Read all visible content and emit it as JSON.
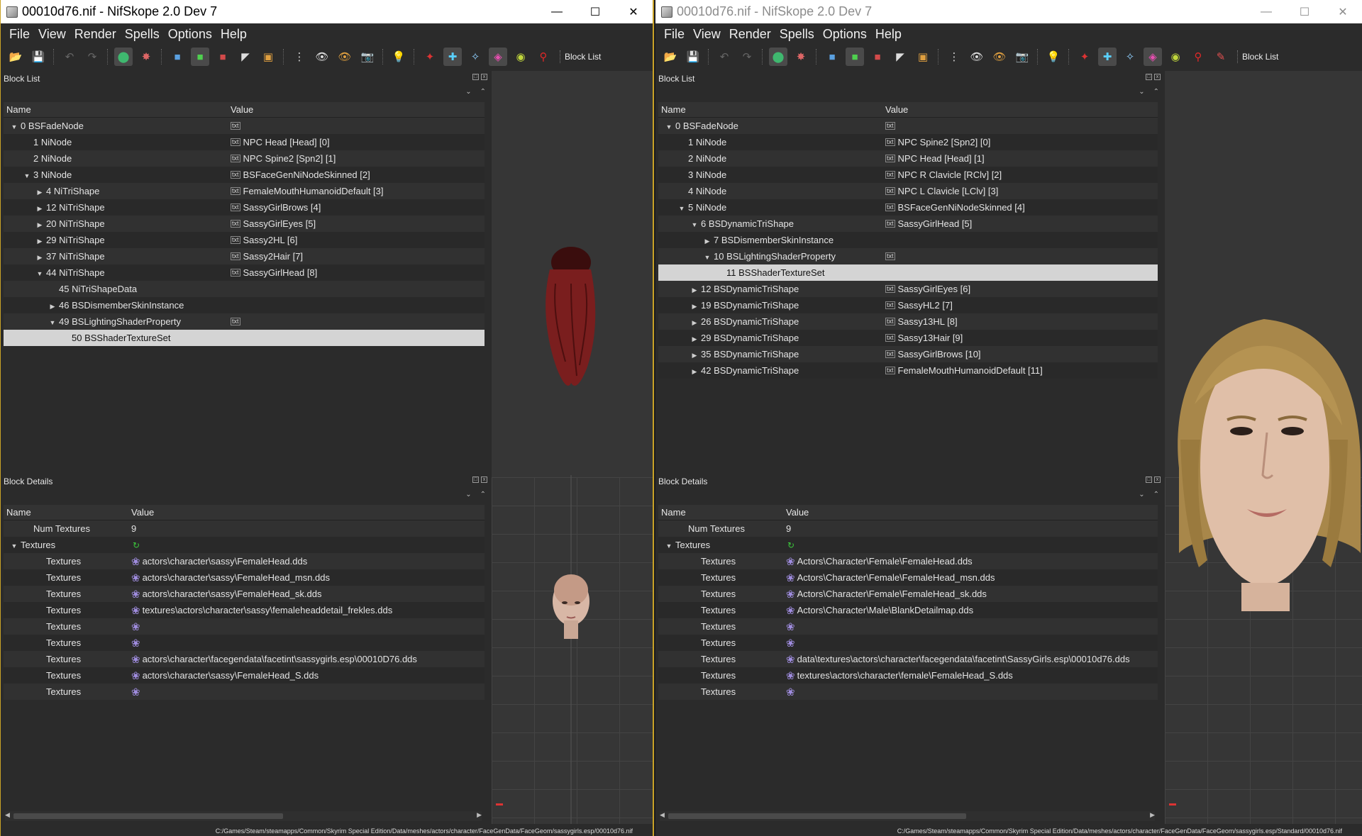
{
  "left": {
    "title": "00010d76.nif - NifSkope 2.0 Dev 7",
    "menu": [
      "File",
      "View",
      "Render",
      "Spells",
      "Options",
      "Help"
    ],
    "blocklist_button": "Block List",
    "block_list": {
      "title": "Block List",
      "headers": [
        "Name",
        "Value"
      ],
      "rows": [
        {
          "indent": 0,
          "arrow": "down",
          "name": "0 BSFadeNode",
          "icon": true,
          "value": ""
        },
        {
          "indent": 1,
          "arrow": "",
          "name": "1 NiNode",
          "icon": true,
          "value": "NPC Head [Head] [0]"
        },
        {
          "indent": 1,
          "arrow": "",
          "name": "2 NiNode",
          "icon": true,
          "value": "NPC Spine2 [Spn2] [1]"
        },
        {
          "indent": 1,
          "arrow": "down",
          "name": "3 NiNode",
          "icon": true,
          "value": "BSFaceGenNiNodeSkinned [2]"
        },
        {
          "indent": 2,
          "arrow": "right",
          "name": "4 NiTriShape",
          "icon": true,
          "value": "FemaleMouthHumanoidDefault [3]"
        },
        {
          "indent": 2,
          "arrow": "right",
          "name": "12 NiTriShape",
          "icon": true,
          "value": "SassyGirlBrows [4]"
        },
        {
          "indent": 2,
          "arrow": "right",
          "name": "20 NiTriShape",
          "icon": true,
          "value": "SassyGirlEyes [5]"
        },
        {
          "indent": 2,
          "arrow": "right",
          "name": "29 NiTriShape",
          "icon": true,
          "value": "Sassy2HL [6]"
        },
        {
          "indent": 2,
          "arrow": "right",
          "name": "37 NiTriShape",
          "icon": true,
          "value": "Sassy2Hair [7]"
        },
        {
          "indent": 2,
          "arrow": "down",
          "name": "44 NiTriShape",
          "icon": true,
          "value": "SassyGirlHead [8]"
        },
        {
          "indent": 3,
          "arrow": "",
          "name": "45 NiTriShapeData",
          "icon": false,
          "value": ""
        },
        {
          "indent": 3,
          "arrow": "right",
          "name": "46 BSDismemberSkinInstance",
          "icon": false,
          "value": ""
        },
        {
          "indent": 3,
          "arrow": "down",
          "name": "49 BSLightingShaderProperty",
          "icon": true,
          "value": ""
        },
        {
          "indent": 4,
          "arrow": "",
          "name": "50 BSShaderTextureSet",
          "icon": false,
          "value": "",
          "selected": true
        }
      ]
    },
    "block_details": {
      "title": "Block Details",
      "headers": [
        "Name",
        "Value"
      ],
      "rows": [
        {
          "indent": 1,
          "arrow": "",
          "name": "Num Textures",
          "icon": "",
          "value": "9"
        },
        {
          "indent": 0,
          "arrow": "down",
          "name": "Textures",
          "icon": "refresh",
          "value": ""
        },
        {
          "indent": 2,
          "arrow": "",
          "name": "Textures",
          "icon": "gear",
          "value": "actors\\character\\sassy\\FemaleHead.dds"
        },
        {
          "indent": 2,
          "arrow": "",
          "name": "Textures",
          "icon": "gear",
          "value": "actors\\character\\sassy\\FemaleHead_msn.dds"
        },
        {
          "indent": 2,
          "arrow": "",
          "name": "Textures",
          "icon": "gear",
          "value": "actors\\character\\sassy\\FemaleHead_sk.dds"
        },
        {
          "indent": 2,
          "arrow": "",
          "name": "Textures",
          "icon": "gear",
          "value": "textures\\actors\\character\\sassy\\femaleheaddetail_frekles.dds"
        },
        {
          "indent": 2,
          "arrow": "",
          "name": "Textures",
          "icon": "gear",
          "value": ""
        },
        {
          "indent": 2,
          "arrow": "",
          "name": "Textures",
          "icon": "gear",
          "value": ""
        },
        {
          "indent": 2,
          "arrow": "",
          "name": "Textures",
          "icon": "gear",
          "value": "actors\\character\\facegendata\\facetint\\sassygirls.esp\\00010D76.dds"
        },
        {
          "indent": 2,
          "arrow": "",
          "name": "Textures",
          "icon": "gear",
          "value": "actors\\character\\sassy\\FemaleHead_S.dds"
        },
        {
          "indent": 2,
          "arrow": "",
          "name": "Textures",
          "icon": "gear",
          "value": ""
        }
      ]
    },
    "status": "C:/Games/Steam/steamapps/Common/Skyrim Special Edition/Data/meshes/actors/character/FaceGenData/FaceGeom/sassygirls.esp/00010d76.nif"
  },
  "right": {
    "title": "00010d76.nif - NifSkope 2.0 Dev 7",
    "menu": [
      "File",
      "View",
      "Render",
      "Spells",
      "Options",
      "Help"
    ],
    "blocklist_button": "Block List",
    "block_list": {
      "title": "Block List",
      "headers": [
        "Name",
        "Value"
      ],
      "rows": [
        {
          "indent": 0,
          "arrow": "down",
          "name": "0 BSFadeNode",
          "icon": true,
          "value": ""
        },
        {
          "indent": 1,
          "arrow": "",
          "name": "1 NiNode",
          "icon": true,
          "value": "NPC Spine2 [Spn2] [0]"
        },
        {
          "indent": 1,
          "arrow": "",
          "name": "2 NiNode",
          "icon": true,
          "value": "NPC Head [Head] [1]"
        },
        {
          "indent": 1,
          "arrow": "",
          "name": "3 NiNode",
          "icon": true,
          "value": "NPC R Clavicle [RClv] [2]"
        },
        {
          "indent": 1,
          "arrow": "",
          "name": "4 NiNode",
          "icon": true,
          "value": "NPC L Clavicle [LClv] [3]"
        },
        {
          "indent": 1,
          "arrow": "down",
          "name": "5 NiNode",
          "icon": true,
          "value": "BSFaceGenNiNodeSkinned [4]"
        },
        {
          "indent": 2,
          "arrow": "down",
          "name": "6 BSDynamicTriShape",
          "icon": true,
          "value": "SassyGirlHead [5]"
        },
        {
          "indent": 3,
          "arrow": "right",
          "name": "7 BSDismemberSkinInstance",
          "icon": false,
          "value": ""
        },
        {
          "indent": 3,
          "arrow": "down",
          "name": "10 BSLightingShaderProperty",
          "icon": true,
          "value": ""
        },
        {
          "indent": 4,
          "arrow": "",
          "name": "11 BSShaderTextureSet",
          "icon": false,
          "value": "",
          "selected": true
        },
        {
          "indent": 2,
          "arrow": "right",
          "name": "12 BSDynamicTriShape",
          "icon": true,
          "value": "SassyGirlEyes [6]"
        },
        {
          "indent": 2,
          "arrow": "right",
          "name": "19 BSDynamicTriShape",
          "icon": true,
          "value": "SassyHL2 [7]"
        },
        {
          "indent": 2,
          "arrow": "right",
          "name": "26 BSDynamicTriShape",
          "icon": true,
          "value": "Sassy13HL [8]"
        },
        {
          "indent": 2,
          "arrow": "right",
          "name": "29 BSDynamicTriShape",
          "icon": true,
          "value": "Sassy13Hair [9]"
        },
        {
          "indent": 2,
          "arrow": "right",
          "name": "35 BSDynamicTriShape",
          "icon": true,
          "value": "SassyGirlBrows [10]"
        },
        {
          "indent": 2,
          "arrow": "right",
          "name": "42 BSDynamicTriShape",
          "icon": true,
          "value": "FemaleMouthHumanoidDefault [11]"
        }
      ]
    },
    "block_details": {
      "title": "Block Details",
      "headers": [
        "Name",
        "Value"
      ],
      "rows": [
        {
          "indent": 1,
          "arrow": "",
          "name": "Num Textures",
          "icon": "",
          "value": "9"
        },
        {
          "indent": 0,
          "arrow": "down",
          "name": "Textures",
          "icon": "refresh",
          "value": ""
        },
        {
          "indent": 2,
          "arrow": "",
          "name": "Textures",
          "icon": "gear",
          "value": "Actors\\Character\\Female\\FemaleHead.dds"
        },
        {
          "indent": 2,
          "arrow": "",
          "name": "Textures",
          "icon": "gear",
          "value": "Actors\\Character\\Female\\FemaleHead_msn.dds"
        },
        {
          "indent": 2,
          "arrow": "",
          "name": "Textures",
          "icon": "gear",
          "value": "Actors\\Character\\Female\\FemaleHead_sk.dds"
        },
        {
          "indent": 2,
          "arrow": "",
          "name": "Textures",
          "icon": "gear",
          "value": "Actors\\Character\\Male\\BlankDetailmap.dds"
        },
        {
          "indent": 2,
          "arrow": "",
          "name": "Textures",
          "icon": "gear",
          "value": ""
        },
        {
          "indent": 2,
          "arrow": "",
          "name": "Textures",
          "icon": "gear",
          "value": ""
        },
        {
          "indent": 2,
          "arrow": "",
          "name": "Textures",
          "icon": "gear",
          "value": "data\\textures\\actors\\character\\facegendata\\facetint\\SassyGirls.esp\\00010d76.dds"
        },
        {
          "indent": 2,
          "arrow": "",
          "name": "Textures",
          "icon": "gear",
          "value": "textures\\actors\\character\\female\\FemaleHead_S.dds"
        },
        {
          "indent": 2,
          "arrow": "",
          "name": "Textures",
          "icon": "gear",
          "value": ""
        }
      ]
    },
    "status": "C:/Games/Steam/steamapps/Common/Skyrim Special Edition/Data/meshes/actors/character/FaceGenData/FaceGeom/sassygirls.esp/Standard/00010d76.nif"
  },
  "colors": {
    "panel_bg": "#2b2b2b",
    "selection": "#d4d4d4",
    "active_frame": "#c9a227",
    "hair_left": "#7a1e1e",
    "hair_right": "#a8874a"
  }
}
